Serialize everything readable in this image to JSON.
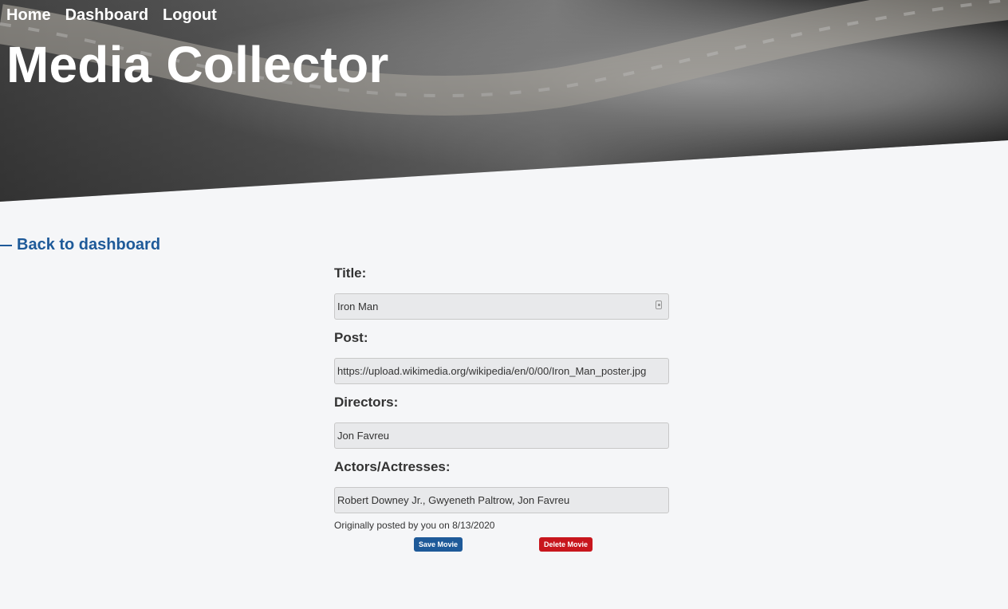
{
  "nav": {
    "home": "Home",
    "dashboard": "Dashboard",
    "logout": "Logout"
  },
  "site": {
    "title": "Media Collector"
  },
  "back_link": "Back to dashboard",
  "form": {
    "title_label": "Title:",
    "title_value": "Iron Man",
    "post_label": "Post:",
    "post_value": "https://upload.wikimedia.org/wikipedia/en/0/00/Iron_Man_poster.jpg",
    "directors_label": "Directors:",
    "directors_value": "Jon Favreu",
    "actors_label": "Actors/Actresses:",
    "actors_value": "Robert Downey Jr., Gwyeneth Paltrow, Jon Favreu"
  },
  "posted_info": "Originally posted by you on 8/13/2020",
  "buttons": {
    "save": "Save Movie",
    "delete": "Delete Movie"
  },
  "colors": {
    "accent": "#1e5a99",
    "danger": "#c8161d",
    "background": "#f5f6f8"
  },
  "icons": {
    "back": "arrow-left-icon",
    "field": "password-manager-icon"
  }
}
